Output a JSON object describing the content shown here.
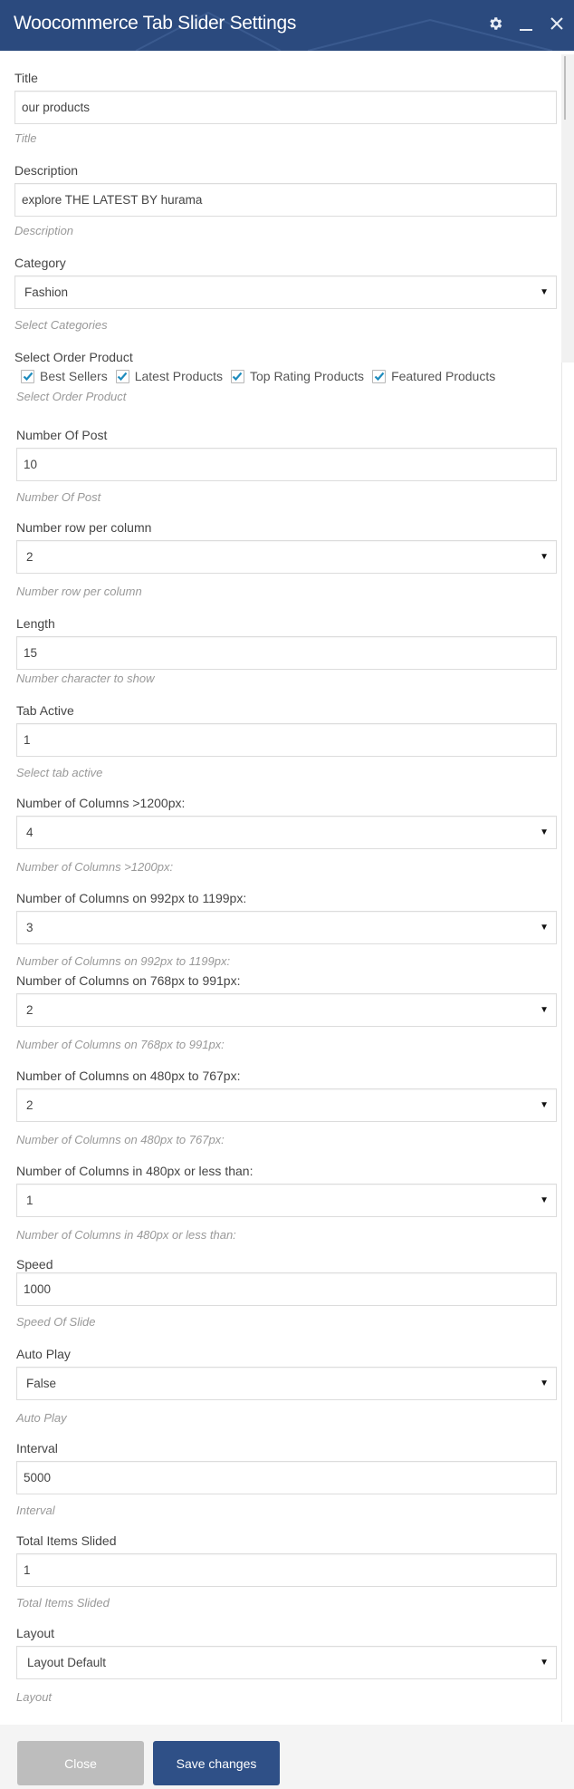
{
  "header": {
    "title": "Woocommerce Tab Slider Settings",
    "icons": [
      "gear-icon",
      "minimize-icon",
      "close-icon"
    ]
  },
  "colors": {
    "header_bg": "#2b4a7e",
    "save_button": "#2f5087",
    "close_button": "#bdbdbd",
    "checkbox_check": "#1e8cbe"
  },
  "fields": {
    "title": {
      "label": "Title",
      "value": "our products",
      "help": "Title"
    },
    "description": {
      "label": "Description",
      "value": "explore THE LATEST BY hurama",
      "help": "Description"
    },
    "category": {
      "label": "Category",
      "value": "Fashion",
      "help": "Select Categories"
    },
    "order_product": {
      "label": "Select Order Product",
      "options": [
        {
          "label": "Best Sellers",
          "checked": true
        },
        {
          "label": "Latest Products",
          "checked": true
        },
        {
          "label": "Top Rating Products",
          "checked": true
        },
        {
          "label": "Featured Products",
          "checked": true
        }
      ],
      "help": "Select Order Product"
    },
    "number_of_post": {
      "label": "Number Of Post",
      "value": "10",
      "help": "Number Of Post"
    },
    "rows_per_column": {
      "label": "Number row per column",
      "value": "2",
      "help": "Number row per column"
    },
    "length": {
      "label": "Length",
      "value": "15",
      "help": "Number character to show"
    },
    "tab_active": {
      "label": "Tab Active",
      "value": "1",
      "help": "Select tab active"
    },
    "cols_1200": {
      "label": "Number of Columns >1200px:",
      "value": "4",
      "help": "Number of Columns >1200px:"
    },
    "cols_992": {
      "label": "Number of Columns on 992px to 1199px:",
      "value": "3",
      "help": "Number of Columns on 992px to 1199px:"
    },
    "cols_768": {
      "label": "Number of Columns on 768px to 991px:",
      "value": "2",
      "help": "Number of Columns on 768px to 991px:"
    },
    "cols_480": {
      "label": "Number of Columns on 480px to 767px:",
      "value": "2",
      "help": "Number of Columns on 480px to 767px:"
    },
    "cols_less_480": {
      "label": "Number of Columns in 480px or less than:",
      "value": "1",
      "help": "Number of Columns in 480px or less than:"
    },
    "speed": {
      "label": "Speed",
      "value": "1000",
      "help": "Speed Of Slide"
    },
    "auto_play": {
      "label": "Auto Play",
      "value": "False",
      "help": "Auto Play"
    },
    "interval": {
      "label": "Interval",
      "value": "5000",
      "help": "Interval"
    },
    "total_items_slided": {
      "label": "Total Items Slided",
      "value": "1",
      "help": "Total Items Slided"
    },
    "layout": {
      "label": "Layout",
      "value": "Layout Default",
      "help": "Layout"
    }
  },
  "footer": {
    "close_label": "Close",
    "save_label": "Save changes"
  }
}
